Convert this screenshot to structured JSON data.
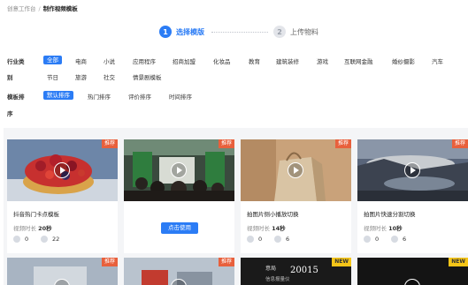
{
  "breadcrumb": {
    "root": "创意工作台",
    "separator": "/",
    "current": "制作视频模板"
  },
  "steps": [
    {
      "num": "1",
      "label": "选择模版"
    },
    {
      "num": "2",
      "label": "上传物料"
    }
  ],
  "filters": {
    "industry": {
      "label": "行业类",
      "label_wrap": "别",
      "active": "全部",
      "items": [
        "电商",
        "小说",
        "应用程序",
        "招商加盟",
        "化妆品",
        "教育",
        "建筑装修",
        "游戏",
        "互联网金融",
        "婚纱摄影",
        "汽车",
        "节日",
        "旅游",
        "社交",
        "情景剧模板"
      ]
    },
    "sort": {
      "label": "模板排",
      "label_wrap": "序",
      "active": "默认排序",
      "items": [
        "热门排序",
        "评价排序",
        "时间排序"
      ]
    }
  },
  "cards": [
    {
      "title": "抖音热门卡点模板",
      "duration_label": "视频时长",
      "duration": "20秒",
      "likes": "0",
      "uses": "22",
      "badge": "推荐"
    },
    {
      "badge": "推荐",
      "button": "点击使用"
    },
    {
      "title": "拍图片侧小播放切换",
      "duration_label": "视频时长",
      "duration": "14秒",
      "likes": "0",
      "uses": "6",
      "badge": "推荐"
    },
    {
      "title": "拍图片快速分割切换",
      "duration_label": "视频时长",
      "duration": "10秒",
      "likes": "0",
      "uses": "6",
      "badge": "推荐"
    }
  ],
  "cards_row2": [
    {
      "badge": "推荐"
    },
    {
      "badge": "推荐"
    },
    {
      "badge": "NEW",
      "thumb_text_1": "意局",
      "thumb_text_2": "20015",
      "thumb_text_3": "信息报量仪"
    },
    {
      "badge": "NEW"
    }
  ],
  "colors": {
    "accent": "#2b7cf5",
    "badge": "#e8603c",
    "badge_new": "#f5c518"
  }
}
